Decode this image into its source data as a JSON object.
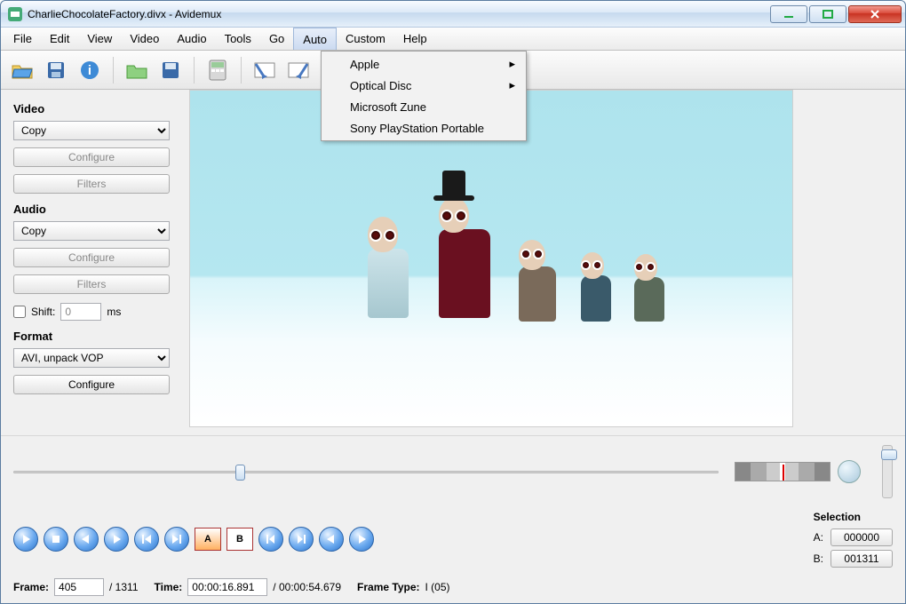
{
  "window": {
    "title": "CharlieChocolateFactory.divx - Avidemux"
  },
  "menubar": [
    "File",
    "Edit",
    "View",
    "Video",
    "Audio",
    "Tools",
    "Go",
    "Auto",
    "Custom",
    "Help"
  ],
  "menubar_active": "Auto",
  "dropdown": {
    "items": [
      {
        "label": "Apple",
        "submenu": true
      },
      {
        "label": "Optical Disc",
        "submenu": true
      },
      {
        "label": "Microsoft Zune",
        "submenu": false
      },
      {
        "label": "Sony PlayStation Portable",
        "submenu": false
      }
    ]
  },
  "sidebar": {
    "video": {
      "label": "Video",
      "codec": "Copy",
      "configure": "Configure",
      "filters": "Filters"
    },
    "audio": {
      "label": "Audio",
      "codec": "Copy",
      "configure": "Configure",
      "filters": "Filters",
      "shift_label": "Shift:",
      "shift_value": "0",
      "shift_unit": "ms"
    },
    "format": {
      "label": "Format",
      "container": "AVI, unpack VOP",
      "configure": "Configure"
    }
  },
  "selection": {
    "label": "Selection",
    "a_label": "A:",
    "a_value": "000000",
    "b_label": "B:",
    "b_value": "001311"
  },
  "status": {
    "frame_label": "Frame:",
    "frame_current": "405",
    "frame_total": "/ 1311",
    "time_label": "Time:",
    "time_current": "00:00:16.891",
    "time_total": "/ 00:00:54.679",
    "frametype_label": "Frame Type:",
    "frametype_value": "I (05)"
  }
}
